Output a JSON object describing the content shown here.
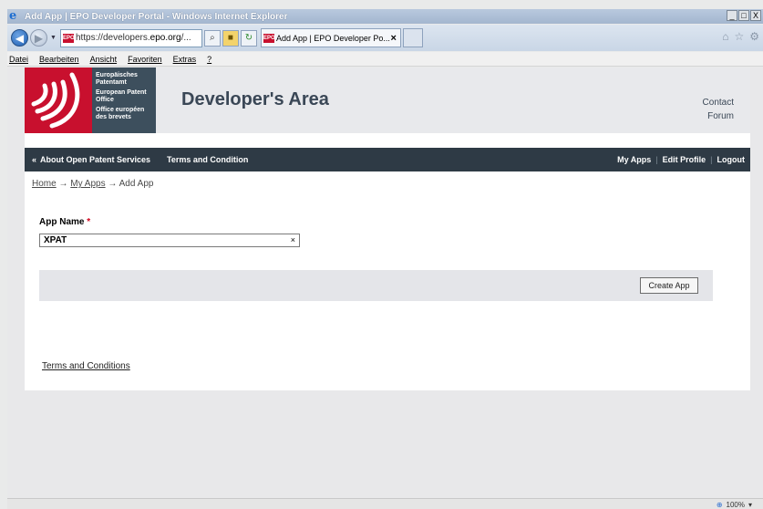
{
  "window": {
    "title": "Add App | EPO Developer Portal - Windows Internet Explorer",
    "controls": [
      "_",
      "□",
      "X"
    ]
  },
  "browser": {
    "url_prefix": "https://developers.",
    "url_domain": "epo.org",
    "url_suffix": "/...",
    "tab_title": "Add App | EPO Developer Po...",
    "tab_close": "×",
    "favicon_text": "EPO"
  },
  "menu": [
    "Datei",
    "Bearbeiten",
    "Ansicht",
    "Favoriten",
    "Extras",
    "?"
  ],
  "header": {
    "logo_lines": [
      "Europäisches Patentamt",
      "European Patent Office",
      "Office européen des brevets"
    ],
    "title": "Developer's Area",
    "links": [
      "Contact",
      "Forum"
    ]
  },
  "nav": {
    "left": [
      "About Open Patent Services",
      "Terms and Condition"
    ],
    "right": [
      "My Apps",
      "Edit Profile",
      "Logout"
    ],
    "sep": "|"
  },
  "breadcrumb": {
    "home": "Home",
    "arrow": "→",
    "my_apps": "My Apps",
    "current": "Add App"
  },
  "form": {
    "app_name_label": "App Name",
    "required_mark": "*",
    "app_name_value": "XPAT",
    "clear": "×",
    "create_button": "Create App"
  },
  "footer": {
    "terms_link": "Terms and Conditions"
  },
  "status": {
    "zoom": "100%"
  }
}
